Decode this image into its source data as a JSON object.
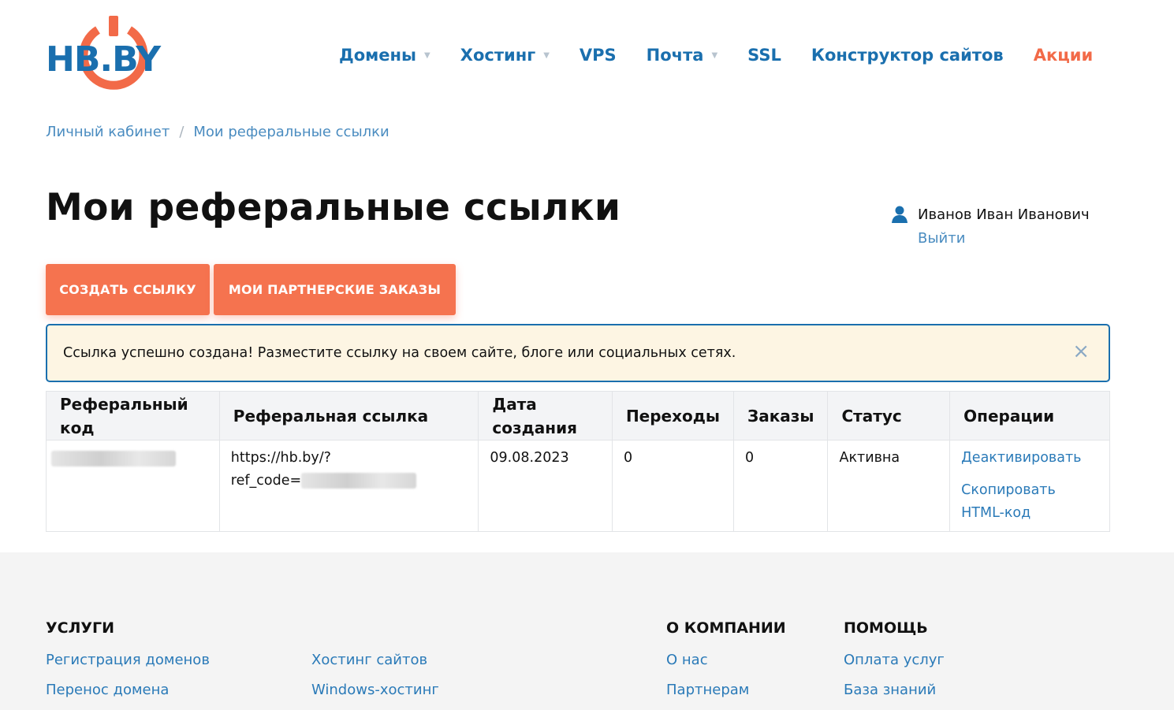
{
  "logo": {
    "text": "HB.BY"
  },
  "nav": {
    "domains": "Домены",
    "hosting": "Хостинг",
    "vps": "VPS",
    "mail": "Почта",
    "ssl": "SSL",
    "builder": "Конструктор сайтов",
    "promo": "Акции"
  },
  "breadcrumb": {
    "home": "Личный кабинет",
    "separator": "/",
    "current": "Мои реферальные ссылки"
  },
  "page": {
    "title": "Мои реферальные ссылки"
  },
  "user": {
    "name": "Иванов Иван Иванович",
    "logout": "Выйти"
  },
  "buttons": {
    "create": "СОЗДАТЬ ССЫЛКУ",
    "orders": "МОИ ПАРТНЕРСКИЕ ЗАКАЗЫ"
  },
  "alert": {
    "message": "Ссылка успешно создана! Разместите ссылку на своем сайте, блоге или социальных сетях.",
    "close": "×"
  },
  "table": {
    "headers": {
      "code": "Реферальный код",
      "link": "Реферальная ссылка",
      "date": "Дата создания",
      "clicks": "Переходы",
      "orders": "Заказы",
      "status": "Статус",
      "ops": "Операции"
    },
    "rows": [
      {
        "link_line1": "https://hb.by/?",
        "link_line2": "ref_code=",
        "date": "09.08.2023",
        "clicks": "0",
        "orders": "0",
        "status": "Активна",
        "op_deactivate": "Деактивировать",
        "op_copy": "Скопировать HTML-код"
      }
    ]
  },
  "footer": {
    "services_title": "УСЛУГИ",
    "company_title": "О КОМПАНИИ",
    "help_title": "ПОМОЩЬ",
    "links": {
      "domain_reg": "Регистрация доменов",
      "domain_transfer": "Перенос домена",
      "site_hosting": "Хостинг сайтов",
      "windows_hosting": "Windows-хостинг",
      "about": "О нас",
      "partners": "Партнерам",
      "payment": "Оплата услуг",
      "knowledge": "База знаний"
    }
  },
  "colors": {
    "brand_blue": "#1a6fae",
    "accent_orange": "#f5734f",
    "alert_bg": "#fdf5e3"
  }
}
